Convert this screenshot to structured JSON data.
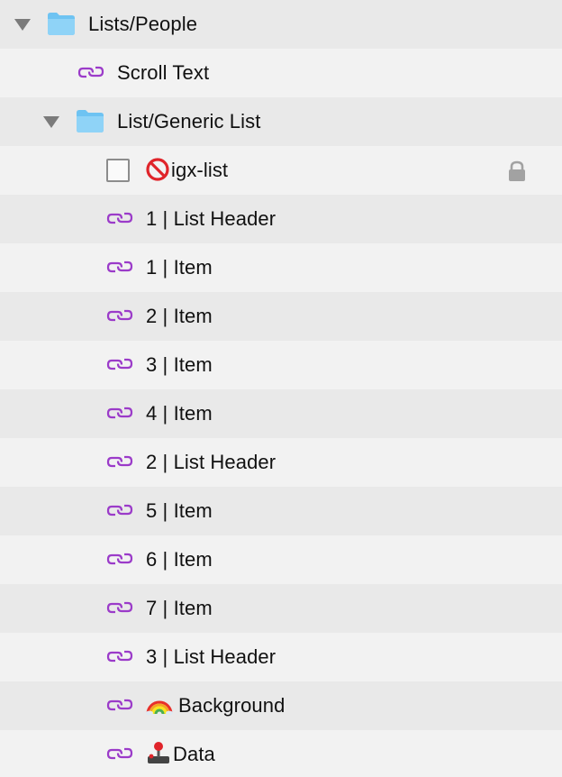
{
  "layers": {
    "root_folder": {
      "label": "Lists/People",
      "icon": "folder-icon",
      "expanded": true
    },
    "scroll_text": {
      "label": "Scroll Text",
      "icon": "symbol-link-icon"
    },
    "generic_folder": {
      "label": "List/Generic List",
      "icon": "folder-icon",
      "expanded": true
    },
    "igx_list": {
      "label": "igx-list",
      "icon": "no-entry-icon",
      "locked": true
    },
    "items": [
      {
        "label": "1 | List Header"
      },
      {
        "label": "1 | Item"
      },
      {
        "label": "2 | Item"
      },
      {
        "label": "3 | Item"
      },
      {
        "label": "4 | Item"
      },
      {
        "label": "2 | List Header"
      },
      {
        "label": "5 | Item"
      },
      {
        "label": "6 | Item"
      },
      {
        "label": "7 | Item"
      },
      {
        "label": "3 | List Header"
      }
    ],
    "background": {
      "label": "Background",
      "icon": "rainbow-icon"
    },
    "data": {
      "label": "Data",
      "icon": "joystick-icon"
    }
  },
  "colors": {
    "folder_blue": "#6ec3f2",
    "symbol_purple": "#9b3bc9",
    "row_dark": "#e9e9e9",
    "row_light": "#f2f2f2"
  }
}
